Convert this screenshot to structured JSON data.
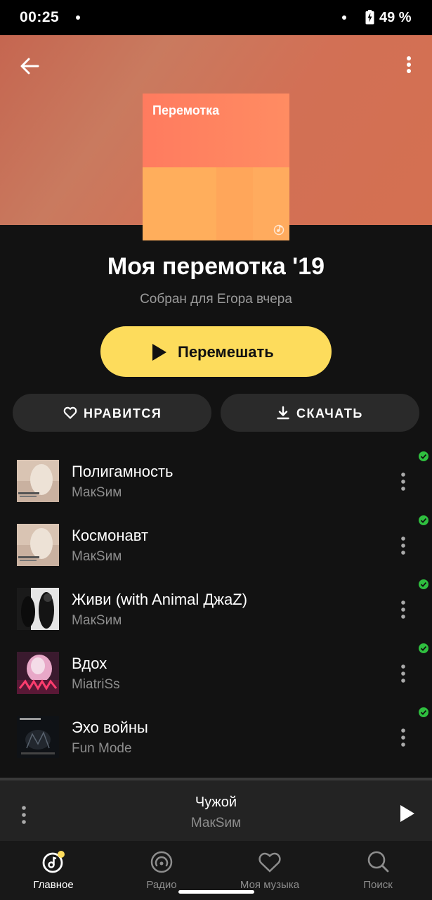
{
  "status_bar": {
    "time": "00:25",
    "battery": "49 %"
  },
  "playlist": {
    "cover_title": "Перемотка",
    "title": "Моя перемотка '19",
    "subtitle": "Собран для Егора вчера"
  },
  "actions": {
    "shuffle_label": "Перемешать",
    "like_label": "НРАВИТСЯ",
    "download_label": "СКАЧАТЬ"
  },
  "tracks": [
    {
      "title": "Полигамность",
      "artist": "МакSим",
      "downloaded": true
    },
    {
      "title": "Космонавт",
      "artist": "МакSим",
      "downloaded": true
    },
    {
      "title": "Живи (with Animal ДжаZ)",
      "artist": "МакSим",
      "downloaded": true
    },
    {
      "title": "Вдох",
      "artist": "MiatriSs",
      "downloaded": true
    },
    {
      "title": "Эхо войны",
      "artist": "Fun Mode",
      "downloaded": true
    }
  ],
  "now_playing": {
    "title": "Чужой",
    "artist": "МакSим"
  },
  "nav": [
    {
      "label": "Главное",
      "icon": "home-icon",
      "active": true
    },
    {
      "label": "Радио",
      "icon": "radio-icon",
      "active": false
    },
    {
      "label": "Моя музыка",
      "icon": "heart-icon",
      "active": false
    },
    {
      "label": "Поиск",
      "icon": "search-icon",
      "active": false
    }
  ],
  "colors": {
    "accent": "#fddc5c",
    "check": "#2fbf3f",
    "header": "#c97a5f"
  }
}
